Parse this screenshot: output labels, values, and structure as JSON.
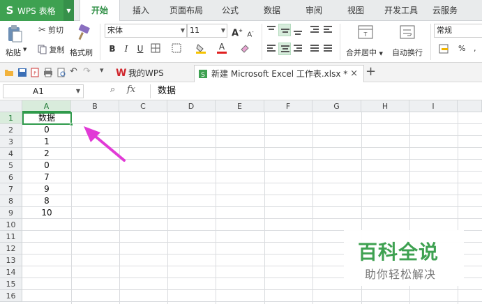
{
  "app": {
    "name": "WPS 表格",
    "logo_glyph": "S"
  },
  "menu": {
    "tabs": [
      "开始",
      "插入",
      "页面布局",
      "公式",
      "数据",
      "审阅",
      "视图",
      "开发工具",
      "云服务"
    ],
    "active": "开始"
  },
  "ribbon": {
    "paste": "粘贴",
    "cut": "剪切",
    "copy": "复制",
    "format_painter": "格式刷",
    "font_name": "宋体",
    "font_size": "11",
    "bold": "B",
    "italic": "I",
    "underline": "U",
    "grow_font": "A",
    "shrink_font": "A",
    "font_color_glyph": "A",
    "merge_center": "合并居中",
    "wrap_text": "自动换行",
    "number_format": "常规",
    "percent": "%"
  },
  "doc_tabs": [
    {
      "label": "我的WPS"
    },
    {
      "label": "新建 Microsoft Excel 工作表.xlsx *"
    }
  ],
  "doc_tab_add": "+",
  "doc_tab_close": "×",
  "formula_bar": {
    "name_box": "A1",
    "fx": "fx",
    "content": "数据"
  },
  "columns": [
    "A",
    "B",
    "C",
    "D",
    "E",
    "F",
    "G",
    "H",
    "I"
  ],
  "rows": [
    "1",
    "2",
    "3",
    "4",
    "5",
    "6",
    "7",
    "8",
    "9",
    "10",
    "11",
    "12",
    "13",
    "14",
    "15",
    "16"
  ],
  "sheet": {
    "a1": "数据",
    "a2": "0",
    "a3": "1",
    "a4": "2",
    "a5": "0",
    "a6": "7",
    "a7": "9",
    "a8": "8",
    "a9": "10"
  },
  "watermark": {
    "title": "百科全说",
    "subtitle": "助你轻松解决"
  },
  "colors": {
    "accent": "#3ea151",
    "arrow": "#e13ad6"
  }
}
